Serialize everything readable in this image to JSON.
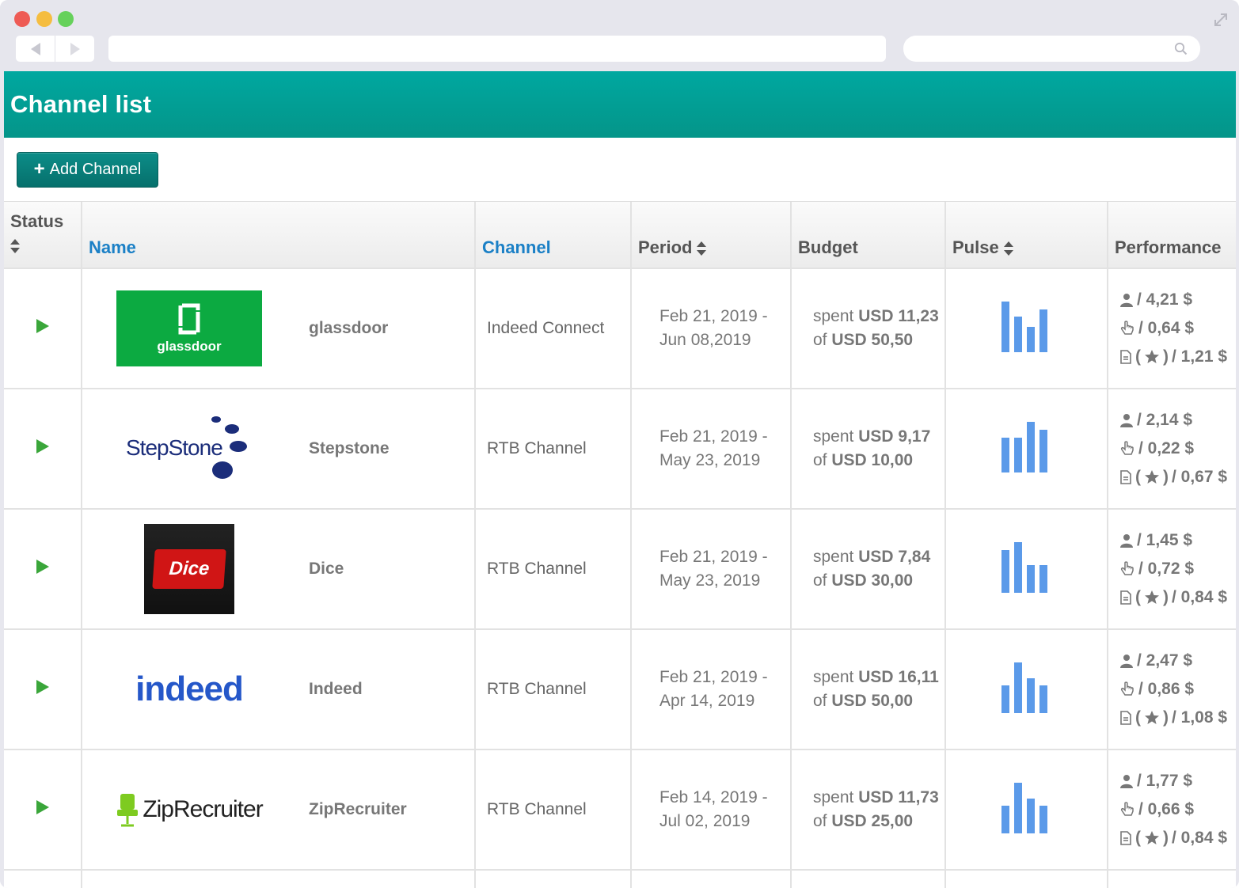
{
  "page": {
    "title": "Channel list"
  },
  "toolbar": {
    "add_label": "Add Channel"
  },
  "table": {
    "headers": {
      "status": "Status",
      "name": "Name",
      "channel": "Channel",
      "period": "Period",
      "budget": "Budget",
      "pulse": "Pulse",
      "performance": "Performance"
    },
    "rows": [
      {
        "name": "glassdoor",
        "logo": "glassdoor-logo",
        "logo_text": "glassdoor",
        "channel": "Indeed Connect",
        "period_start": "Feb 21, 2019 -",
        "period_end": "Jun 08,2019",
        "spent_prefix": "spent",
        "spent": "USD 11,23",
        "of_prefix": "of",
        "total": "USD 50,50",
        "pulse": [
          1.0,
          0.7,
          0.5,
          0.85
        ],
        "perf_user": "/ 4,21 $",
        "perf_click": "/ 0,64 $",
        "perf_doc": "/ 1,21 $"
      },
      {
        "name": "Stepstone",
        "logo": "stepstone-logo",
        "logo_text": "StepStone",
        "channel": "RTB Channel",
        "period_start": "Feb 21, 2019 -",
        "period_end": "May 23, 2019",
        "spent_prefix": "spent",
        "spent": "USD 9,17",
        "of_prefix": "of",
        "total": "USD 10,00",
        "pulse": [
          0.68,
          0.68,
          1.0,
          0.85
        ],
        "perf_user": "/ 2,14 $",
        "perf_click": "/ 0,22 $",
        "perf_doc": "/ 0,67 $"
      },
      {
        "name": "Dice",
        "logo": "dice-logo",
        "logo_text": "Dice",
        "channel": "RTB Channel",
        "period_start": "Feb 21, 2019 -",
        "period_end": "May 23, 2019",
        "spent_prefix": "spent",
        "spent": "USD 7,84",
        "of_prefix": "of",
        "total": "USD 30,00",
        "pulse": [
          0.85,
          1.0,
          0.55,
          0.55
        ],
        "perf_user": "/ 1,45 $",
        "perf_click": "/ 0,72 $",
        "perf_doc": "/ 0,84 $"
      },
      {
        "name": "Indeed",
        "logo": "indeed-logo",
        "logo_text": "indeed",
        "channel": "RTB Channel",
        "period_start": "Feb 21, 2019 -",
        "period_end": "Apr 14, 2019",
        "spent_prefix": "spent",
        "spent": "USD 16,11",
        "of_prefix": "of",
        "total": "USD 50,00",
        "pulse": [
          0.55,
          1.0,
          0.68,
          0.55
        ],
        "perf_user": "/ 2,47 $",
        "perf_click": "/ 0,86 $",
        "perf_doc": "/ 1,08 $"
      },
      {
        "name": "ZipRecruiter",
        "logo": "ziprecruiter-logo",
        "logo_text": "ZipRecruiter",
        "channel": "RTB Channel",
        "period_start": "Feb 14, 2019 -",
        "period_end": "Jul 02, 2019",
        "spent_prefix": "spent",
        "spent": "USD 11,73",
        "of_prefix": "of",
        "total": "USD 25,00",
        "pulse": [
          0.55,
          1.0,
          0.68,
          0.55
        ],
        "perf_user": "/ 1,77 $",
        "perf_click": "/ 0,66 $",
        "perf_doc": "/ 0,84 $"
      }
    ],
    "perf_star_open": "(",
    "perf_star_close": ")"
  },
  "colors": {
    "header": "#00a8a0",
    "accent_blue": "#1b80c6",
    "status_play": "#3aa63a",
    "pulse_bar": "#5b9ae9"
  }
}
